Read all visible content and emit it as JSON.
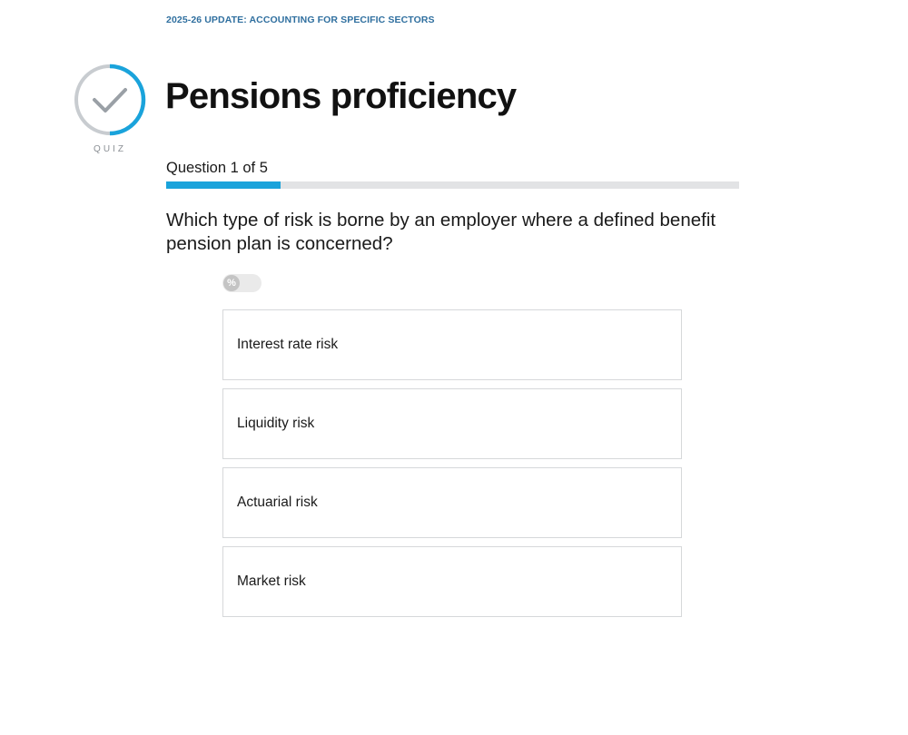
{
  "breadcrumb": "2025-26 UPDATE: ACCOUNTING FOR SPECIFIC SECTORS",
  "badge": {
    "label": "QUIZ",
    "icon": "checkmark-icon",
    "ring_progress": 0.5
  },
  "title": "Pensions proficiency",
  "progress": {
    "label": "Question 1 of 5",
    "current": 1,
    "total": 5,
    "fraction": 0.2
  },
  "question": "Which type of risk is borne by an employer where a defined benefit pension plan is concerned?",
  "percent_toggle": {
    "symbol": "%",
    "on": false
  },
  "answers": [
    {
      "label": "Interest rate risk"
    },
    {
      "label": "Liquidity risk"
    },
    {
      "label": "Actuarial risk"
    },
    {
      "label": "Market risk"
    }
  ],
  "colors": {
    "accent": "#1aa3db",
    "breadcrumb": "#2f6f9f",
    "track": "#e2e3e5",
    "badge_ring": "#c8ccd0"
  }
}
